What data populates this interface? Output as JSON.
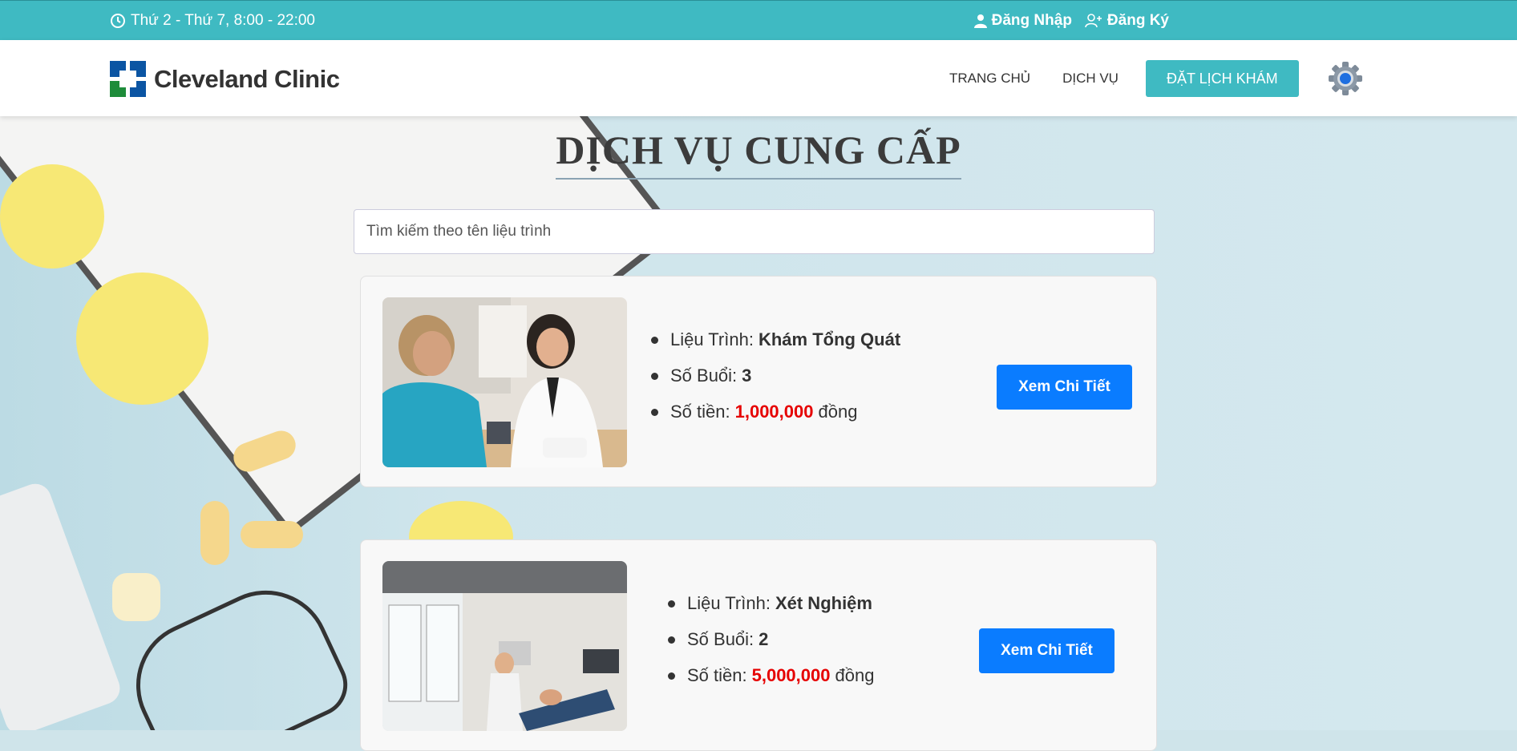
{
  "topbar": {
    "hours": "Thứ 2 - Thứ 7, 8:00 - 22:00",
    "login": "Đăng Nhập",
    "register": "Đăng Ký"
  },
  "header": {
    "logo_text": "Cleveland Clinic",
    "nav": [
      "TRANG CHỦ",
      "DỊCH VỤ"
    ],
    "book_button": "ĐẶT LỊCH KHÁM"
  },
  "main": {
    "title": "DỊCH VỤ CUNG CẤP",
    "search_placeholder": "Tìm kiếm theo tên liệu trình",
    "labels": {
      "program": "Liệu Trình:",
      "sessions": "Số Buổi:",
      "price": "Số tiền:",
      "currency": "đồng",
      "detail_button": "Xem Chi Tiết"
    },
    "services": [
      {
        "name": "Khám Tổng Quát",
        "sessions": "3",
        "price": "1,000,000"
      },
      {
        "name": "Xét Nghiệm",
        "sessions": "2",
        "price": "5,000,000"
      }
    ]
  },
  "colors": {
    "topbar": "#3fbac2",
    "button_primary": "#0a7cff",
    "price_red": "#e60000"
  }
}
